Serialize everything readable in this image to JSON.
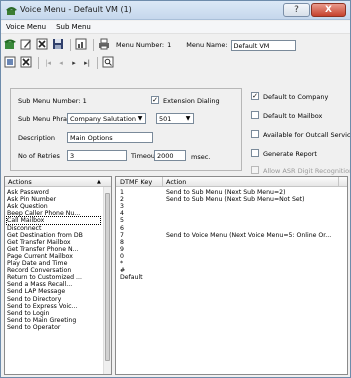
{
  "window": {
    "title": "Voice Menu - Default VM (1)",
    "help_label": "?",
    "close_label": "X"
  },
  "menubar": {
    "items": [
      "Voice Menu",
      "Sub Menu"
    ]
  },
  "toolbar": {
    "menu_number_label": "Menu Number:",
    "menu_number_value": "1",
    "menu_name_label": "Menu Name:",
    "menu_name_value": "Default VM",
    "nav": [
      "|◂",
      "◂",
      "▸",
      "▸|"
    ]
  },
  "submenu": {
    "number_label": "Sub Menu Number: 1",
    "extension_dialing_label": "Extension Dialing",
    "extension_dialing_checked": true,
    "phrase_label": "Sub Menu Phrase",
    "phrase_value": "Company Salutation",
    "phrase_code": "501",
    "description_label": "Description",
    "description_value": "Main Options",
    "retries_label": "No of Retries",
    "retries_value": "3",
    "timeout_label": "Timeout",
    "timeout_value": "2000",
    "timeout_unit": "msec."
  },
  "options": [
    {
      "label": "Default to Company",
      "checked": true,
      "disabled": false
    },
    {
      "label": "Default to Mailbox",
      "checked": false,
      "disabled": false
    },
    {
      "label": "Available for Outcall Services",
      "checked": false,
      "disabled": false
    },
    {
      "label": "Generate Report",
      "checked": false,
      "disabled": false
    },
    {
      "label": "Allow ASR Digit Recognition",
      "checked": false,
      "disabled": true
    }
  ],
  "actions": {
    "header": "Actions",
    "sort_indicator": "▲",
    "selected_index": 5,
    "items": [
      "Ask Password",
      "Ask Pin Number",
      "Ask Question",
      "Beep Caller Phone Nu...",
      "Call Mailbox",
      "Disconnect",
      "Get Destination from DB",
      "Get Transfer Mailbox",
      "Get Transfer Phone N...",
      "Page Current Mailbox",
      "Play Date and Time",
      "Record Conversation",
      "Return to Customized ...",
      "Send a Mass Recall...",
      "Send LAP Message",
      "Send to Directory",
      "Send to Express Voic...",
      "Send to Login",
      "Send to Main Greeting",
      "Send to Operator"
    ]
  },
  "dtmf": {
    "key_header": "DTMF Key",
    "action_header": "Action",
    "rows": [
      {
        "key": "1",
        "action": "Send to Sub Menu (Next Sub Menu=2)"
      },
      {
        "key": "2",
        "action": "Send to Sub Menu (Next Sub Menu=Not Set)"
      },
      {
        "key": "3",
        "action": ""
      },
      {
        "key": "4",
        "action": ""
      },
      {
        "key": "5",
        "action": ""
      },
      {
        "key": "6",
        "action": ""
      },
      {
        "key": "7",
        "action": "Send to Voice Menu (Next Voice Menu=5: Online Or..."
      },
      {
        "key": "8",
        "action": ""
      },
      {
        "key": "9",
        "action": ""
      },
      {
        "key": "0",
        "action": ""
      },
      {
        "key": "*",
        "action": ""
      },
      {
        "key": "#",
        "action": ""
      },
      {
        "key": "Default",
        "action": ""
      }
    ]
  }
}
